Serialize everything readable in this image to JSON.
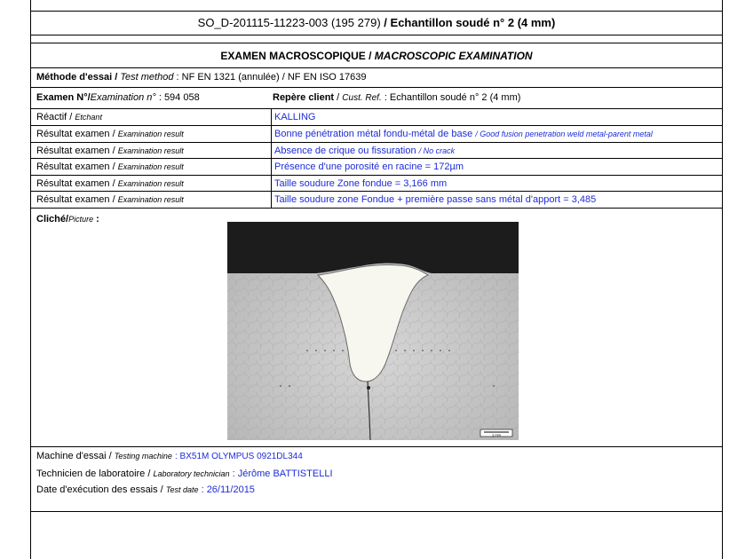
{
  "header": {
    "ref_code": "SO_D-201115-11223-003 (195 279)",
    "separator": "/",
    "sample_title": "Echantillon soudé n° 2 (4 mm)"
  },
  "section": {
    "title_fr": "EXAMEN MACROSCOPIQUE",
    "separator": "/",
    "title_en": "MACROSCOPIC EXAMINATION"
  },
  "method": {
    "label_fr": "Méthode d'essai /",
    "label_en": "Test method",
    "value": ": NF EN 1321 (annulée) / NF EN ISO 17639"
  },
  "exam": {
    "label_fr": "Examen N°/",
    "label_en": "Examination n°",
    "value": ": 594 058",
    "client_label_fr": "Repère client",
    "client_sep": "/",
    "client_label_en": "Cust. Ref.",
    "client_value": ": Echantillon soudé n° 2 (4 mm)"
  },
  "rows": [
    {
      "label_fr": "Réactif /",
      "label_en": "Etchant",
      "value": "KALLING",
      "value_en": ""
    },
    {
      "label_fr": "Résultat examen /",
      "label_en": "Examination result",
      "value": "Bonne pénétration métal fondu-métal de base",
      "value_en": "/ Good fusion penetration weld metal-parent metal"
    },
    {
      "label_fr": "Résultat examen /",
      "label_en": "Examination result",
      "value": "Absence de crique ou fissuration",
      "value_en": "/ No crack"
    },
    {
      "label_fr": "Résultat examen /",
      "label_en": "Examination result",
      "value": "Présence d'une porosité en racine = 172µm",
      "value_en": ""
    },
    {
      "label_fr": "Résultat examen /",
      "label_en": "Examination result",
      "value": "Taille soudure Zone fondue = 3,166 mm",
      "value_en": ""
    },
    {
      "label_fr": "Résultat examen /",
      "label_en": "Examination result",
      "value": "Taille soudure zone Fondue + première passe sans métal d'apport = 3,485",
      "value_en": ""
    }
  ],
  "picture": {
    "label_fr": "Cliché/",
    "label_en": "Picture",
    "label_colon": ":",
    "scale_label": "1 mm"
  },
  "footer": {
    "machine_label_fr": "Machine d'essai /",
    "machine_label_en": "Testing machine",
    "machine_value": ": BX51M OLYMPUS 0921DL344",
    "tech_label_fr": "Technicien de laboratoire /",
    "tech_label_en": "Laboratory technician",
    "tech_value": ": Jérôme BATTISTELLI",
    "date_label_fr": "Date d'exécution des essais /",
    "date_label_en": "Test date",
    "date_value": ": 26/11/2015"
  },
  "colors": {
    "accent_blue": "#1d2bd6",
    "line": "#000000"
  }
}
